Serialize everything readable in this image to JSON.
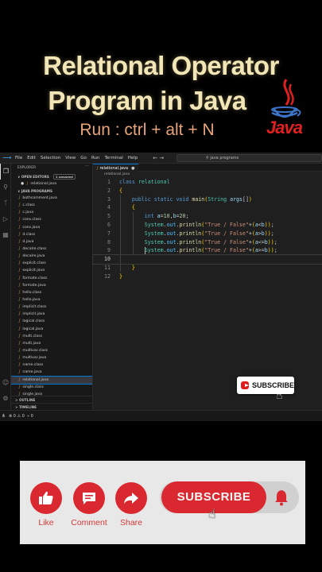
{
  "banner": {
    "title_line1": "Relational Operator",
    "title_line2": "Program in Java",
    "run_hint": "Run : ctrl + alt + N",
    "logo_text": "Java"
  },
  "menubar": {
    "items": [
      "File",
      "Edit",
      "Selection",
      "View",
      "Go",
      "Run",
      "Terminal",
      "Help"
    ],
    "nav": "←  →",
    "search_text": "java programs"
  },
  "sidebar": {
    "explorer_title": "EXPLORER",
    "open_editors_title": "OPEN EDITORS",
    "unsaved_badge": "1 unsaved",
    "open_editor_file": "relational.java",
    "folder_title": "JAVA PROGRAMS",
    "files": [
      "bothcomment.java",
      "c.class",
      "c.java",
      "cons.class",
      "cons.java",
      "d.class",
      "d.java",
      "decalre.class",
      "decalre.java",
      "explicit.class",
      "explicit.java",
      "formate.class",
      "formate.java",
      "hello.class",
      "hello.java",
      "implicit.class",
      "implicit.java",
      "logical.class",
      "logical.java",
      "multi.class",
      "multi.java",
      "multivar.class",
      "multivar.java",
      "name.class",
      "name.java",
      "relational.java",
      "single.class",
      "single.java"
    ],
    "selected_file": "relational.java",
    "outline_title": "OUTLINE",
    "timeline_title": "TIMELINE"
  },
  "editor": {
    "tab_label": "relational.java",
    "breadcrumb": "relational.java",
    "lines": [
      {
        "n": "1",
        "text": "class relational"
      },
      {
        "n": "2",
        "text": "{"
      },
      {
        "n": "3",
        "text": "    public static void main(String args[])"
      },
      {
        "n": "4",
        "text": "    {"
      },
      {
        "n": "5",
        "text": "        int a=10,b=20;"
      },
      {
        "n": "6",
        "text": "        System.out.println(\"True / False\"+(a<b));"
      },
      {
        "n": "7",
        "text": "        System.out.println(\"True / False\"+(a>b));"
      },
      {
        "n": "8",
        "text": "        System.out.println(\"True / False\"+(a<=b));"
      },
      {
        "n": "9",
        "text": "        System.out.println(\"True / False\"+(a>=b));"
      },
      {
        "n": "10",
        "text": ""
      },
      {
        "n": "11",
        "text": "    }"
      },
      {
        "n": "12",
        "text": "}"
      }
    ],
    "current_line": "10"
  },
  "statusbar": {
    "errors": "⊗ 0 ⚠ 0",
    "ports": "⑂ 0"
  },
  "mini_subscribe": {
    "label": "SUBSCRIBE"
  },
  "panel": {
    "like_label": "Like",
    "comment_label": "Comment",
    "share_label": "Share",
    "subscribe_label": "SUBSCRIBE"
  },
  "colors": {
    "accent_red": "#d9282f",
    "title_cream": "#f2e6b6",
    "run_hint_orange": "#e8a47a",
    "vscode_bg": "#1e1e1e"
  }
}
